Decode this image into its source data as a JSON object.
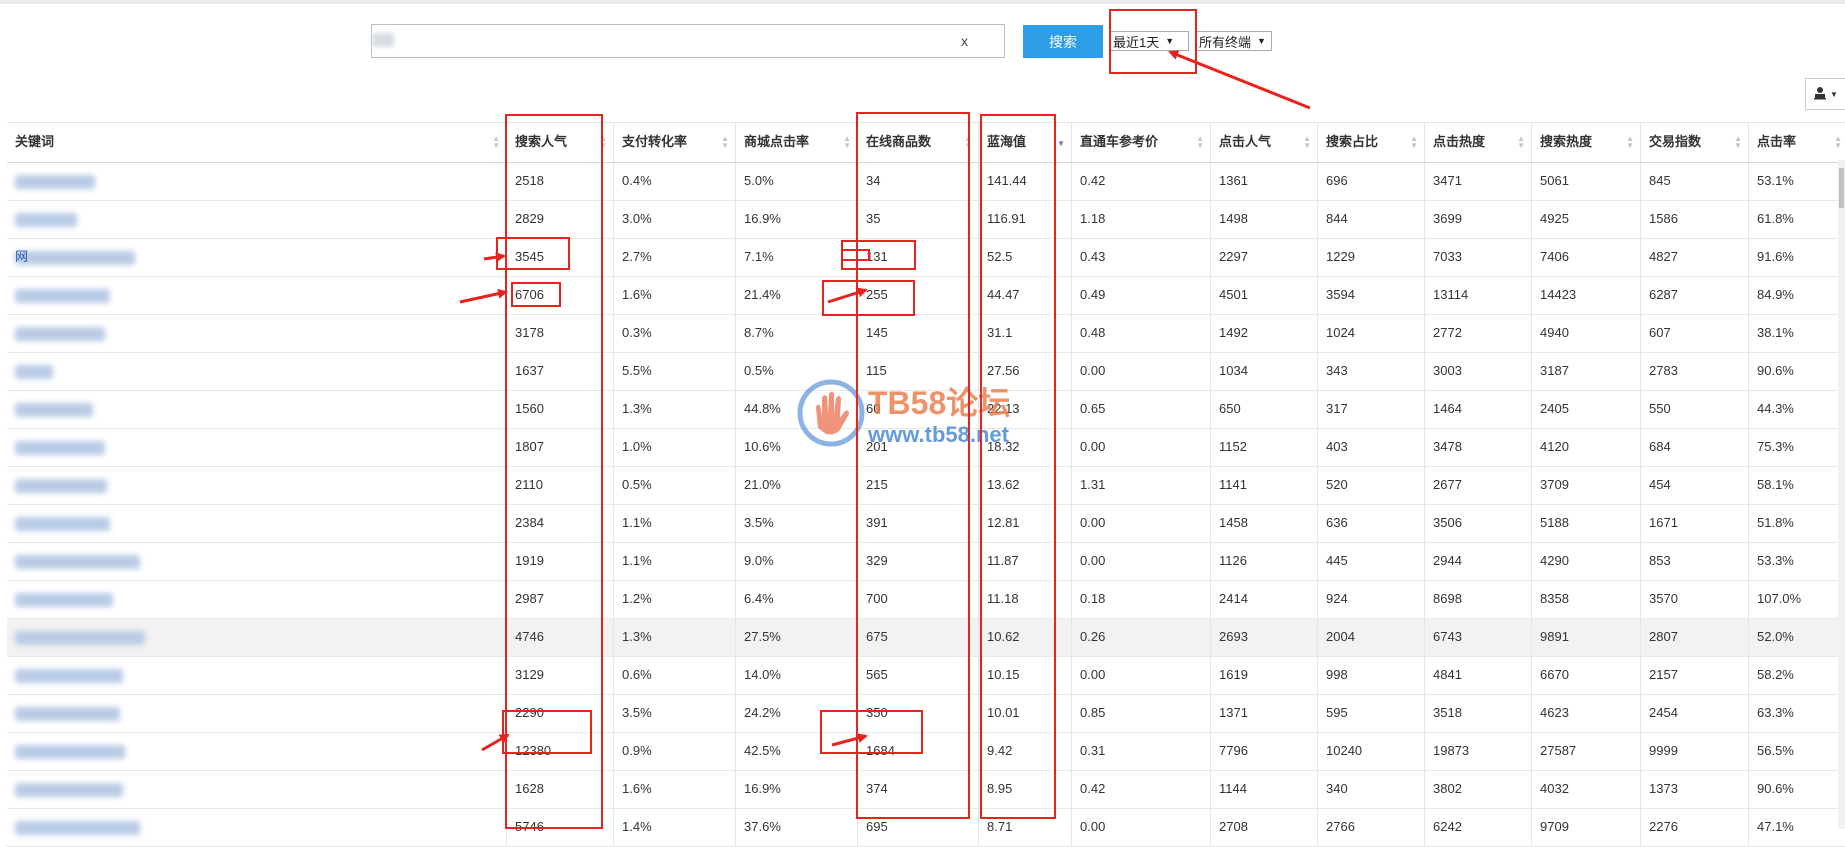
{
  "search": {
    "value": "",
    "clear_label": "x",
    "button_label": "搜索"
  },
  "filters": {
    "period": "最近1天",
    "terminal": "所有终端"
  },
  "export": {
    "icon": "user-export-icon"
  },
  "table": {
    "columns": [
      "关键词",
      "搜索人气",
      "支付转化率",
      "商城点击率",
      "在线商品数",
      "蓝海值",
      "直通车参考价",
      "点击人气",
      "搜索占比",
      "点击热度",
      "搜索热度",
      "交易指数",
      "点击率"
    ],
    "sorted_column": "蓝海值",
    "rows": [
      {
        "kw": "",
        "v": [
          "2518",
          "0.4%",
          "5.0%",
          "34",
          "141.44",
          "0.42",
          "1361",
          "696",
          "3471",
          "5061",
          "845",
          "53.1%"
        ]
      },
      {
        "kw": "",
        "v": [
          "2829",
          "3.0%",
          "16.9%",
          "35",
          "116.91",
          "1.18",
          "1498",
          "844",
          "3699",
          "4925",
          "1586",
          "61.8%"
        ]
      },
      {
        "kw": "网",
        "v": [
          "3545",
          "2.7%",
          "7.1%",
          "131",
          "52.5",
          "0.43",
          "2297",
          "1229",
          "7033",
          "7406",
          "4827",
          "91.6%"
        ]
      },
      {
        "kw": "",
        "v": [
          "6706",
          "1.6%",
          "21.4%",
          "255",
          "44.47",
          "0.49",
          "4501",
          "3594",
          "13114",
          "14423",
          "6287",
          "84.9%"
        ]
      },
      {
        "kw": "",
        "v": [
          "3178",
          "0.3%",
          "8.7%",
          "145",
          "31.1",
          "0.48",
          "1492",
          "1024",
          "2772",
          "4940",
          "607",
          "38.1%"
        ]
      },
      {
        "kw": "",
        "v": [
          "1637",
          "5.5%",
          "0.5%",
          "115",
          "27.56",
          "0.00",
          "1034",
          "343",
          "3003",
          "3187",
          "2783",
          "90.6%"
        ]
      },
      {
        "kw": "",
        "v": [
          "1560",
          "1.3%",
          "44.8%",
          "60",
          "22.13",
          "0.65",
          "650",
          "317",
          "1464",
          "2405",
          "550",
          "44.3%"
        ]
      },
      {
        "kw": "",
        "v": [
          "1807",
          "1.0%",
          "10.6%",
          "201",
          "18.32",
          "0.00",
          "1152",
          "403",
          "3478",
          "4120",
          "684",
          "75.3%"
        ]
      },
      {
        "kw": "",
        "v": [
          "2110",
          "0.5%",
          "21.0%",
          "215",
          "13.62",
          "1.31",
          "1141",
          "520",
          "2677",
          "3709",
          "454",
          "58.1%"
        ]
      },
      {
        "kw": "",
        "v": [
          "2384",
          "1.1%",
          "3.5%",
          "391",
          "12.81",
          "0.00",
          "1458",
          "636",
          "3506",
          "5188",
          "1671",
          "51.8%"
        ]
      },
      {
        "kw": "",
        "v": [
          "1919",
          "1.1%",
          "9.0%",
          "329",
          "11.87",
          "0.00",
          "1126",
          "445",
          "2944",
          "4290",
          "853",
          "53.3%"
        ]
      },
      {
        "kw": "",
        "v": [
          "2987",
          "1.2%",
          "6.4%",
          "700",
          "11.18",
          "0.18",
          "2414",
          "924",
          "8698",
          "8358",
          "3570",
          "107.0%"
        ]
      },
      {
        "kw": "",
        "v": [
          "4746",
          "1.3%",
          "27.5%",
          "675",
          "10.62",
          "0.26",
          "2693",
          "2004",
          "6743",
          "9891",
          "2807",
          "52.0%"
        ]
      },
      {
        "kw": "",
        "v": [
          "3129",
          "0.6%",
          "14.0%",
          "565",
          "10.15",
          "0.00",
          "1619",
          "998",
          "4841",
          "6670",
          "2157",
          "58.2%"
        ]
      },
      {
        "kw": "",
        "v": [
          "2290",
          "3.5%",
          "24.2%",
          "350",
          "10.01",
          "0.85",
          "1371",
          "595",
          "3518",
          "4623",
          "2454",
          "63.3%"
        ]
      },
      {
        "kw": "",
        "v": [
          "12380",
          "0.9%",
          "42.5%",
          "1684",
          "9.42",
          "0.31",
          "7796",
          "10240",
          "19873",
          "27587",
          "9999",
          "56.5%"
        ]
      },
      {
        "kw": "",
        "v": [
          "1628",
          "1.6%",
          "16.9%",
          "374",
          "8.95",
          "0.42",
          "1144",
          "340",
          "3802",
          "4032",
          "1373",
          "90.6%"
        ]
      },
      {
        "kw": "",
        "v": [
          "5746",
          "1.4%",
          "37.6%",
          "695",
          "8.71",
          "0.00",
          "2708",
          "2766",
          "6242",
          "9709",
          "2276",
          "47.1%"
        ]
      }
    ]
  },
  "watermark": {
    "title": "TB58论坛",
    "url": "www.tb58.net"
  },
  "colors": {
    "accent": "#2d9ee6",
    "annotation": "#e8231d"
  }
}
